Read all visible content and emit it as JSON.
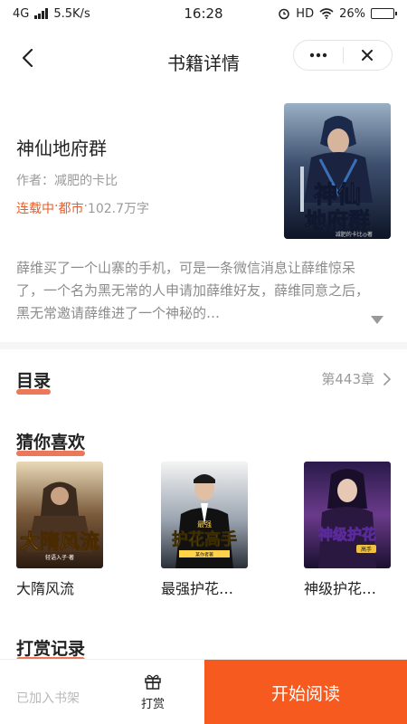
{
  "status_bar": {
    "network": "4G",
    "speed": "5.5K/s",
    "time": "16:28",
    "hd": "HD",
    "battery_pct": "26%",
    "battery_level": 0.26
  },
  "header": {
    "title": "书籍详情"
  },
  "book": {
    "title": "神仙地府群",
    "author": "作者：减肥的卡比",
    "status": "连载中",
    "category": "都市",
    "word_count": "102.7万字",
    "cover_title": "神仙地府群",
    "cover_author": "减肥的卡比◎著",
    "synopsis": "薛维买了一个山寨的手机，可是一条微信消息让薛维惊呆了，一个名为黑无常的人申请加薛维好友，薛维同意之后，黑无常邀请薛维进了一个神秘的…"
  },
  "toc": {
    "title": "目录",
    "latest": "第443章"
  },
  "recommend": {
    "title": "猜你喜欢",
    "items": [
      {
        "name": "大隋风流",
        "cover_title": "大隋风流",
        "cover_author": "轻语入子·著"
      },
      {
        "name": "最强护花…",
        "cover_title": "护花高手",
        "cover_author": "最强",
        "cover_sub": "某作者著"
      },
      {
        "name": "神级护花…",
        "cover_title": "神级护花",
        "cover_author": "高手"
      }
    ]
  },
  "reward_records": {
    "title": "打赏记录"
  },
  "bottom": {
    "shelf_label": "已加入书架",
    "reward_label": "打赏",
    "read_label": "开始阅读"
  },
  "colors": {
    "accent": "#f65a1e",
    "underline": "#e8603c",
    "meta_orange": "#e85d2a"
  }
}
